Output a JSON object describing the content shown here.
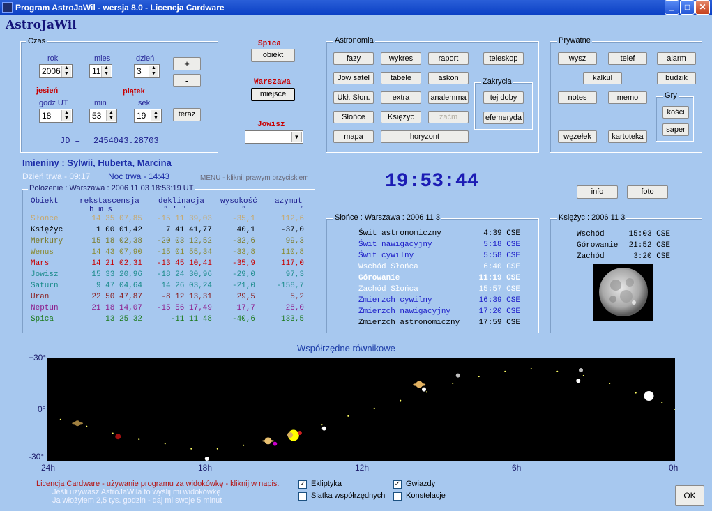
{
  "window": {
    "title": "Program AstroJaWil - wersja 8.0 - Licencja Cardware",
    "minimize": "_",
    "maximize": "□",
    "close": "✕"
  },
  "app_title": "AstroJaWil",
  "czas": {
    "label": "Czas",
    "rok_label": "rok",
    "mies_label": "mies",
    "dzien_label": "dzień",
    "rok": "2006",
    "mies": "11",
    "dzien": "3",
    "plus": "+",
    "minus": "-",
    "season": "jesień",
    "weekday": "piątek",
    "godz_label": "godz UT",
    "min_label": "min",
    "sek_label": "sek",
    "godz": "18",
    "min": "53",
    "sek": "19",
    "teraz": "teraz",
    "jd_label": "JD =",
    "jd": "2454043.28703"
  },
  "spica": {
    "label": "Spica",
    "button": "obiekt"
  },
  "warszawa": {
    "label": "Warszawa",
    "button": "miejsce"
  },
  "jowisz": {
    "label": "Jowisz",
    "value": ""
  },
  "astronomia": {
    "label": "Astronomia",
    "fazy": "fazy",
    "wykres": "wykres",
    "raport": "raport",
    "teleskop": "teleskop",
    "jow_satel": "Jow satel",
    "tabele": "tabele",
    "askon": "askon",
    "ukl_slon": "Ukł. Słon.",
    "extra": "extra",
    "analemma": "analemma",
    "slonce": "Słońce",
    "ksiezyc": "Księżyc",
    "zacm": "zaćm",
    "mapa": "mapa",
    "horyzont": "horyzont",
    "zakrycia_label": "Zakrycia",
    "tej_doby": "tej doby",
    "efemeryda": "efemeryda"
  },
  "prywatne": {
    "label": "Prywatne",
    "wysz": "wysz",
    "telef": "telef",
    "alarm": "alarm",
    "kalkul": "kalkul",
    "budzik": "budzik",
    "notes": "notes",
    "memo": "memo",
    "wezelek": "węzełek",
    "kartoteka": "kartoteka",
    "gry_label": "Gry",
    "kosci": "kości",
    "saper": "saper"
  },
  "imieniny": "Imieniny : Sylwii, Huberta, Marcina",
  "dzien_trwa": "Dzień trwa - 09:17",
  "noc_trwa": "Noc trwa - 14:43",
  "menu_hint": "MENU - kliknij prawym przyciskiem",
  "clock": "19:53:44",
  "info": "info",
  "foto": "foto",
  "polozenie": {
    "label": "Położenie : Warszawa : 2006 11 03    18:53:19 UT",
    "headers": {
      "obiekt": "Obiekt",
      "rekt": "rekstascensja",
      "dekl": "deklinacja",
      "wys": "wysokość",
      "azy": "azymut"
    },
    "sub_hms": "h  m  s",
    "sub_dms": "°  '  \"",
    "sub_deg1": "°",
    "sub_deg2": "°",
    "rows": [
      {
        "name": "Słońce",
        "ra": "14 35 07,85",
        "dec": "-15 11 39,03",
        "alt": "-35,1",
        "az": "112,6",
        "color": "#c8a86a"
      },
      {
        "name": "Księżyc",
        "ra": "1 00 01,42",
        "dec": "7 41 41,77",
        "alt": "40,1",
        "az": "-37,0",
        "color": "#000000"
      },
      {
        "name": "Merkury",
        "ra": "15 18 02,38",
        "dec": "-20 03 12,52",
        "alt": "-32,6",
        "az": "99,3",
        "color": "#7b7b2c"
      },
      {
        "name": "Wenus",
        "ra": "14 43 07,90",
        "dec": "-15 01 55,34",
        "alt": "-33,8",
        "az": "110,8",
        "color": "#8a8a30"
      },
      {
        "name": "Mars",
        "ra": "14 21 02,31",
        "dec": "-13 45 10,41",
        "alt": "-35,9",
        "az": "117,0",
        "color": "#c80000"
      },
      {
        "name": "Jowisz",
        "ra": "15 33 20,96",
        "dec": "-18 24 30,96",
        "alt": "-29,0",
        "az": "97,3",
        "color": "#1c8c8c"
      },
      {
        "name": "Saturn",
        "ra": "9 47 04,64",
        "dec": "14 26 03,24",
        "alt": "-21,0",
        "az": "-158,7",
        "color": "#1c8c8c"
      },
      {
        "name": "Uran",
        "ra": "22 50 47,87",
        "dec": "-8 12 13,31",
        "alt": "29,5",
        "az": "5,2",
        "color": "#8a1c1c"
      },
      {
        "name": "Neptun",
        "ra": "21 18 14,07",
        "dec": "-15 56 17,49",
        "alt": "17,7",
        "az": "28,0",
        "color": "#8c1c8c"
      },
      {
        "name": "Spica",
        "ra": "13 25 32",
        "dec": "-11 11 48",
        "alt": "-40,6",
        "az": "133,5",
        "color": "#1c7a1c"
      }
    ]
  },
  "slonce_panel": {
    "label": "Słońce : Warszawa : 2006 11 3",
    "rows": [
      {
        "name": "Świt astronomiczny",
        "time": "4:39 CSE",
        "color": "#000000",
        "bold": false
      },
      {
        "name": "Świt nawigacyjny",
        "time": "5:18 CSE",
        "color": "#1c1cc8",
        "bold": false
      },
      {
        "name": "Świt cywilny",
        "time": "5:58 CSE",
        "color": "#1c1cc8",
        "bold": false
      },
      {
        "name": "Wschód Słońca",
        "time": "6:40 CSE",
        "color": "#ffffff",
        "bold": false
      },
      {
        "name": "Górowanie",
        "time": "11:19 CSE",
        "color": "#ffffff",
        "bold": true
      },
      {
        "name": "Zachód Słońca",
        "time": "15:57 CSE",
        "color": "#ffffff",
        "bold": false
      },
      {
        "name": "Zmierzch cywilny",
        "time": "16:39 CSE",
        "color": "#1c1cc8",
        "bold": false
      },
      {
        "name": "Zmierzch nawigacyjny",
        "time": "17:20 CSE",
        "color": "#1c1cc8",
        "bold": false
      },
      {
        "name": "Zmierzch astronomiczny",
        "time": "17:59 CSE",
        "color": "#000000",
        "bold": false
      }
    ]
  },
  "ksiezyc_panel": {
    "label": "Księżyc : 2006 11 3",
    "rows": [
      {
        "name": "Wschód",
        "time": "15:03 CSE"
      },
      {
        "name": "Górowanie",
        "time": "21:52 CSE"
      },
      {
        "name": "Zachód",
        "time": "3:20 CSE"
      }
    ]
  },
  "chart_data": {
    "type": "scatter",
    "title": "Współrzędne równikowe",
    "xlabel": "",
    "ylabel": "",
    "x_ticks": [
      "24h",
      "18h",
      "12h",
      "6h",
      "0h"
    ],
    "y_ticks": [
      "+30°",
      "0°",
      "-30°"
    ],
    "xlim": [
      24,
      0
    ],
    "ylim": [
      -30,
      30
    ],
    "objects": [
      {
        "name": "Słońce",
        "ra": 14.59,
        "dec": -15.2,
        "color": "#ffff00",
        "size": 8
      },
      {
        "name": "Księżyc",
        "ra": 1.0,
        "dec": 7.7,
        "color": "#ffffff",
        "size": 7
      },
      {
        "name": "Merkury",
        "ra": 15.3,
        "dec": -20.1,
        "color": "#cc00cc",
        "size": 3
      },
      {
        "name": "Wenus",
        "ra": 14.72,
        "dec": -15.0,
        "color": "#d8b060",
        "size": 4
      },
      {
        "name": "Mars",
        "ra": 14.35,
        "dec": -13.8,
        "color": "#d02020",
        "size": 3
      },
      {
        "name": "Jowisz",
        "ra": 15.56,
        "dec": -18.4,
        "color": "#e8c070",
        "size": 5
      },
      {
        "name": "Saturn",
        "ra": 9.78,
        "dec": 14.4,
        "color": "#e0b060",
        "size": 5
      },
      {
        "name": "Uran",
        "ra": 22.85,
        "dec": -8.2,
        "color": "#a08040",
        "size": 4
      },
      {
        "name": "Neptun",
        "ra": 21.3,
        "dec": -15.9,
        "color": "#a01010",
        "size": 4
      },
      {
        "name": "Spica",
        "ra": 13.42,
        "dec": -11.2,
        "color": "#ffffff",
        "size": 3
      },
      {
        "name": "",
        "ra": 17.9,
        "dec": -30.5,
        "color": "#ffffff",
        "size": 3
      },
      {
        "name": "",
        "ra": 9.6,
        "dec": 11.5,
        "color": "#ffffff",
        "size": 3
      },
      {
        "name": "",
        "ra": 8.3,
        "dec": 19.6,
        "color": "#c0c0c0",
        "size": 3
      },
      {
        "name": "",
        "ra": 3.7,
        "dec": 16.5,
        "color": "#ffffff",
        "size": 3
      },
      {
        "name": "",
        "ra": 3.6,
        "dec": 22.7,
        "color": "#c0c0c0",
        "size": 3
      }
    ],
    "ecliptic": [
      [
        23.5,
        -6
      ],
      [
        22.5,
        -10
      ],
      [
        21.5,
        -14
      ],
      [
        20.5,
        -17.5
      ],
      [
        19.5,
        -20
      ],
      [
        18.5,
        -23
      ],
      [
        17.5,
        -23
      ],
      [
        16.5,
        -21
      ],
      [
        15.5,
        -18.5
      ],
      [
        13.5,
        -9
      ],
      [
        12.5,
        -4
      ],
      [
        11.5,
        0.5
      ],
      [
        10.5,
        5
      ],
      [
        9.5,
        10
      ],
      [
        8.5,
        15
      ],
      [
        7.5,
        19
      ],
      [
        6.5,
        22
      ],
      [
        5.5,
        23.5
      ],
      [
        4.5,
        22
      ],
      [
        3.5,
        19.5
      ],
      [
        2.5,
        15
      ],
      [
        1.5,
        9.5
      ],
      [
        0.5,
        4
      ],
      [
        0,
        0
      ]
    ],
    "grid": false
  },
  "license": {
    "line1": "Licencja Cardware - używanie programu za widokówkę - kliknij w napis.",
    "line2": "Jeśli używasz AstroJaWila to wyślij mi widokówkę",
    "line3": "Ja włożyłem 2,5 tys. godzin - daj mi swoje 5 minut"
  },
  "checks": {
    "ekliptyka": "Ekliptyka",
    "siatka": "Siatka współrzędnych",
    "gwiazdy": "Gwiazdy",
    "konstelacje": "Konstelacje",
    "ekliptyka_on": true,
    "siatka_on": false,
    "gwiazdy_on": true,
    "konstelacje_on": false
  },
  "ok": "OK"
}
